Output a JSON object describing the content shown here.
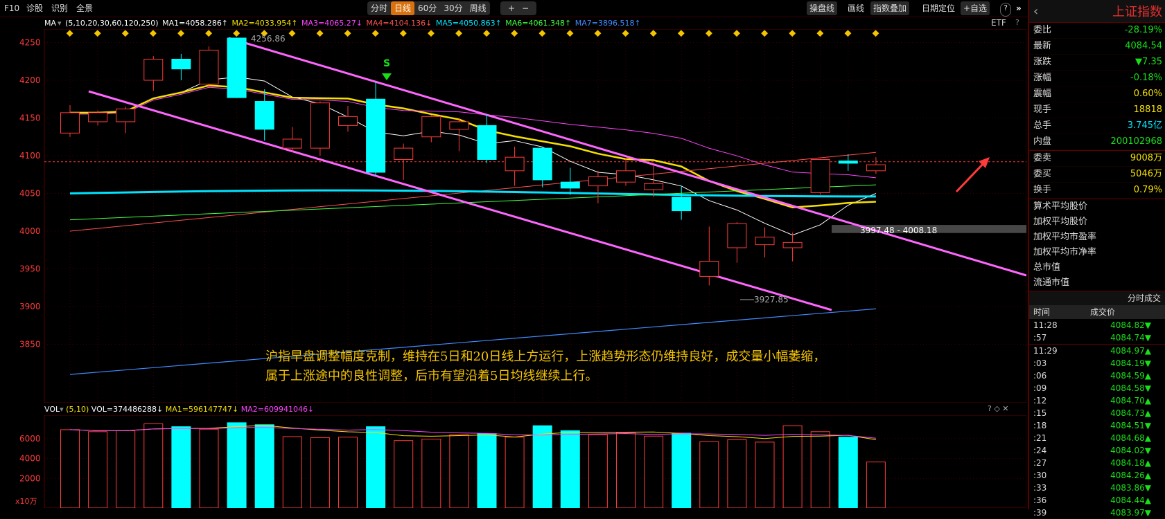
{
  "toolbar": {
    "f10": "F10",
    "diagnose": "诊股",
    "identify": "识别",
    "fullview": "全景",
    "periods": [
      "分时",
      "日线",
      "60分",
      "30分",
      "周线"
    ],
    "active_period": "日线",
    "zoom_in": "+",
    "zoom_out": "−",
    "right_items": [
      "操盘线",
      "画线",
      "指数叠加",
      "日期定位",
      "+自选"
    ],
    "help": "?",
    "collapse": "»"
  },
  "ma_legend": {
    "label": "MA",
    "params": "(5,10,20,30,60,120,250)",
    "items": [
      {
        "text": "MA1=4058.286↑",
        "color": "#ffffff"
      },
      {
        "text": "MA2=4033.954↑",
        "color": "#f5e000"
      },
      {
        "text": "MA3=4065.27↓",
        "color": "#ff44ff"
      },
      {
        "text": "MA4=4104.136↓",
        "color": "#ff5050"
      },
      {
        "text": "MA5=4050.863↑",
        "color": "#00e5ff"
      },
      {
        "text": "MA6=4061.348↑",
        "color": "#40ff40"
      },
      {
        "text": "MA7=3896.518↑",
        "color": "#3f8bff"
      }
    ],
    "etf": "ETF",
    "help": "?"
  },
  "price_axis": {
    "ticks": [
      "4250",
      "4200",
      "4150",
      "4100",
      "4050",
      "4000",
      "3950",
      "3900",
      "3850"
    ]
  },
  "price_annotations": {
    "high": "4256.86",
    "low": "3927.85",
    "gap": "3997.48 - 4008.18",
    "signal": "S"
  },
  "annotation": {
    "line1": "沪指早盘调整幅度克制，维持在5日和20日线上方运行，上涨趋势形态仍维持良好，成交量小幅萎缩，",
    "line2": "属于上涨途中的良性调整，后市有望沿着5日均线继续上行。"
  },
  "vol_legend": {
    "label": "VOL",
    "params": "(5,10)",
    "vol": "VOL=374486288↓",
    "ma1": "MA1=596147747↓",
    "ma2": "MA2=609941046↓",
    "icons": "? ◇ ✕"
  },
  "vol_axis": {
    "ticks": [
      "6000",
      "4000",
      "2000"
    ],
    "unit": "x10万"
  },
  "chart_data": {
    "type": "candlestick",
    "price_range": [
      3800,
      4270
    ],
    "candles": [
      {
        "o": 4130,
        "c": 4157,
        "h": 4167,
        "l": 4125
      },
      {
        "o": 4145,
        "c": 4157,
        "h": 4160,
        "l": 4140
      },
      {
        "o": 4145,
        "c": 4162,
        "h": 4165,
        "l": 4130
      },
      {
        "o": 4200,
        "c": 4228,
        "h": 4232,
        "l": 4186
      },
      {
        "o": 4228,
        "c": 4215,
        "h": 4235,
        "l": 4200
      },
      {
        "o": 4195,
        "c": 4240,
        "h": 4245,
        "l": 4190
      },
      {
        "o": 4256,
        "c": 4177,
        "h": 4256,
        "l": 4177
      },
      {
        "o": 4172,
        "c": 4135,
        "h": 4188,
        "l": 4120
      },
      {
        "o": 4110,
        "c": 4122,
        "h": 4138,
        "l": 4105
      },
      {
        "o": 4110,
        "c": 4170,
        "h": 4172,
        "l": 4100
      },
      {
        "o": 4140,
        "c": 4152,
        "h": 4166,
        "l": 4132
      },
      {
        "o": 4175,
        "c": 4078,
        "h": 4198,
        "l": 4073
      },
      {
        "o": 4095,
        "c": 4110,
        "h": 4116,
        "l": 4068
      },
      {
        "o": 4125,
        "c": 4152,
        "h": 4154,
        "l": 4118
      },
      {
        "o": 4135,
        "c": 4145,
        "h": 4150,
        "l": 4106
      },
      {
        "o": 4140,
        "c": 4095,
        "h": 4155,
        "l": 4090
      },
      {
        "o": 4080,
        "c": 4098,
        "h": 4112,
        "l": 4060
      },
      {
        "o": 4110,
        "c": 4068,
        "h": 4112,
        "l": 4058
      },
      {
        "o": 4065,
        "c": 4057,
        "h": 4084,
        "l": 4048
      },
      {
        "o": 4060,
        "c": 4072,
        "h": 4080,
        "l": 4037
      },
      {
        "o": 4065,
        "c": 4080,
        "h": 4097,
        "l": 4060
      },
      {
        "o": 4055,
        "c": 4063,
        "h": 4088,
        "l": 4045
      },
      {
        "o": 4045,
        "c": 4027,
        "h": 4060,
        "l": 4015
      },
      {
        "o": 3940,
        "c": 3960,
        "h": 4006,
        "l": 3928
      },
      {
        "o": 3978,
        "c": 4010,
        "h": 4012,
        "l": 3958
      },
      {
        "o": 3982,
        "c": 3992,
        "h": 4005,
        "l": 3965
      },
      {
        "o": 3978,
        "c": 3985,
        "h": 3998,
        "l": 3960
      },
      {
        "o": 4051,
        "c": 4095,
        "h": 4096,
        "l": 4048
      },
      {
        "o": 4093,
        "c": 4090,
        "h": 4102,
        "l": 4080
      },
      {
        "o": 4080,
        "c": 4088,
        "h": 4098,
        "l": 4076
      }
    ],
    "volumes": [
      6900,
      6700,
      6800,
      7500,
      7200,
      6950,
      7600,
      7400,
      6200,
      6100,
      6150,
      7200,
      5800,
      5950,
      6400,
      6500,
      6150,
      7300,
      6800,
      6400,
      6600,
      6250,
      6550,
      5700,
      5900,
      5650,
      7300,
      6700,
      6150,
      3650
    ]
  },
  "right_panel": {
    "title": "上证指数",
    "back": "‹",
    "rows": [
      {
        "label": "委比",
        "value": "-28.19%",
        "color": "#18e018"
      },
      {
        "label": "最新",
        "value": "4084.54",
        "color": "#18e018"
      },
      {
        "label": "涨跌",
        "value": "▼7.35",
        "color": "#18e018"
      },
      {
        "label": "涨幅",
        "value": "-0.18%",
        "color": "#18e018"
      },
      {
        "label": "震幅",
        "value": "0.60%",
        "color": "#f5e000"
      },
      {
        "label": "现手",
        "value": "18818",
        "color": "#f5e000"
      },
      {
        "label": "总手",
        "value": "3.745亿",
        "color": "#00e5ff"
      },
      {
        "label": "内盘",
        "value": "200102968",
        "color": "#18e018"
      },
      {
        "label": "委卖",
        "value": "9008万",
        "color": "#f5e000"
      },
      {
        "label": "委买",
        "value": "5046万",
        "color": "#f5e000"
      },
      {
        "label": "换手",
        "value": "0.79%",
        "color": "#f5e000"
      }
    ],
    "list_items": [
      "算术平均股价",
      "加权平均股价",
      "加权平均市盈率",
      "加权平均市净率",
      "总市值",
      "流通市值"
    ],
    "trades_title": "分时成交",
    "trades_head": {
      "time": "时间",
      "price": "成交价"
    },
    "trades": [
      {
        "time": "11:28",
        "price": "4084.82▼"
      },
      {
        "time": ":57",
        "price": "4084.74▼"
      },
      {
        "time": "11:29",
        "price": "4084.97▲"
      },
      {
        "time": ":03",
        "price": "4084.19▼"
      },
      {
        "time": ":06",
        "price": "4084.59▲"
      },
      {
        "time": ":09",
        "price": "4084.58▼"
      },
      {
        "time": ":12",
        "price": "4084.70▲"
      },
      {
        "time": ":15",
        "price": "4084.73▲"
      },
      {
        "time": ":18",
        "price": "4084.51▼"
      },
      {
        "time": ":21",
        "price": "4084.68▲"
      },
      {
        "time": ":24",
        "price": "4084.02▼"
      },
      {
        "time": ":27",
        "price": "4084.18▲"
      },
      {
        "time": ":30",
        "price": "4084.26▲"
      },
      {
        "time": ":33",
        "price": "4083.86▼"
      },
      {
        "time": ":36",
        "price": "4084.44▲"
      },
      {
        "time": ":39",
        "price": "4083.97▼"
      }
    ]
  }
}
